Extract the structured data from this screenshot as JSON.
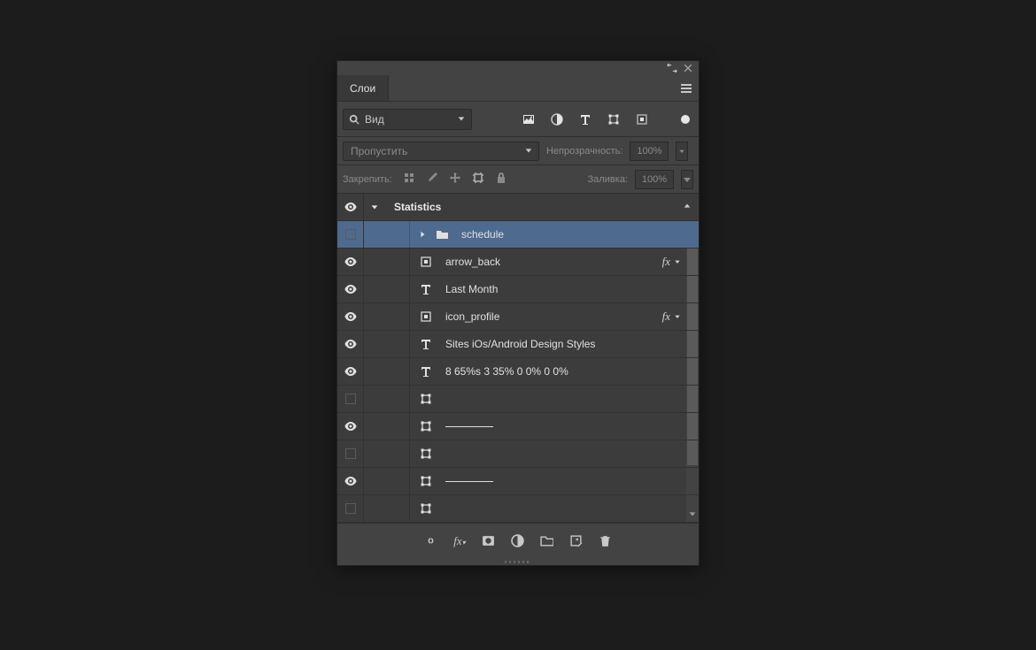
{
  "tab": {
    "label": "Слои"
  },
  "search": {
    "label": "Вид"
  },
  "blend": {
    "mode": "Пропустить"
  },
  "opacity": {
    "label": "Непрозрачность:",
    "value": "100%"
  },
  "lock": {
    "label": "Закрепить:"
  },
  "fill": {
    "label": "Заливка:",
    "value": "100%"
  },
  "group": {
    "name": "Statistics"
  },
  "layers": [
    {
      "vis": "off",
      "type": "folder",
      "name": "schedule",
      "selected": true,
      "chev": true
    },
    {
      "vis": "eye",
      "type": "smart",
      "name": "arrow_back",
      "fx": true
    },
    {
      "vis": "eye",
      "type": "text",
      "name": "Last Month"
    },
    {
      "vis": "eye",
      "type": "smart",
      "name": "icon_profile",
      "fx": true
    },
    {
      "vis": "eye",
      "type": "text",
      "name": "Sites iOs/Android Design Styles"
    },
    {
      "vis": "eye",
      "type": "text",
      "name": "8 65%s 3 35% 0 0% 0 0%"
    },
    {
      "vis": "off",
      "type": "shape",
      "name": ""
    },
    {
      "vis": "eye",
      "type": "shape",
      "name": "",
      "line": true
    },
    {
      "vis": "off",
      "type": "shape",
      "name": ""
    },
    {
      "vis": "eye",
      "type": "shape",
      "name": "",
      "line": true
    },
    {
      "vis": "off",
      "type": "shape",
      "name": ""
    }
  ],
  "fx_label": "fx"
}
